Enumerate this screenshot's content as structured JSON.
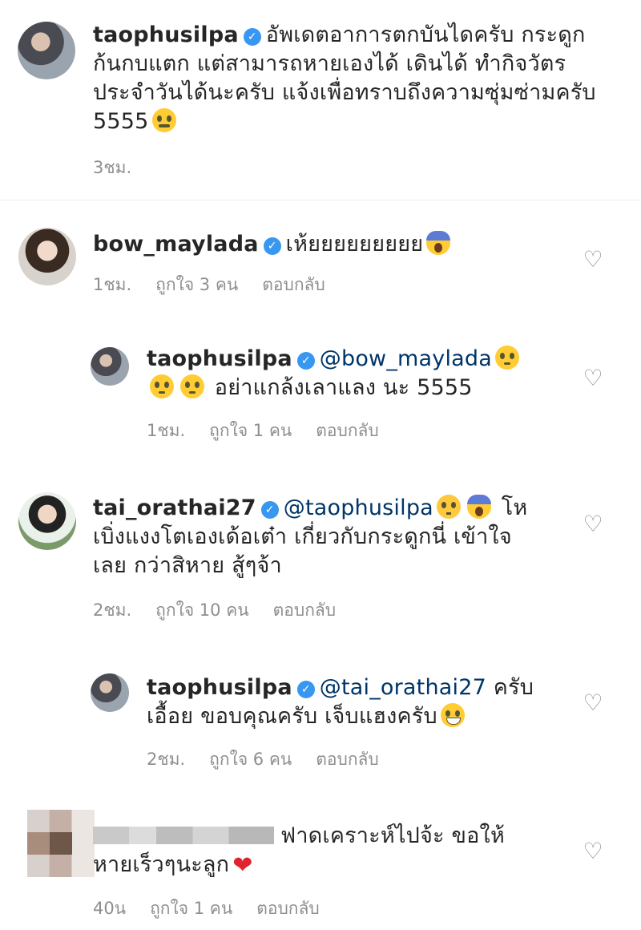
{
  "post": {
    "username": "taophusilpa",
    "caption_line1": "อัพเดตอาการตกบันไดครับ กระดูก",
    "caption_line2": "ก้นกบแตก แต่สามารถหายเองได้ เดินได้ ทำกิจวัตร",
    "caption_line3": "ประจำวันได้นะครับ แจ้งเพื่อทราบถึงความซุ่มซ่ามครับ",
    "caption_line4": "5555",
    "caption_emoji": "confounded-face-icon",
    "time": "3ชม."
  },
  "comments": [
    {
      "username": "bow_maylada",
      "text": "เห้ยยยยยยยยย",
      "emoji": "scream-icon",
      "time": "1ชม.",
      "likes": "ถูกใจ 3 คน",
      "reply_label": "ตอบกลับ"
    },
    {
      "username": "taophusilpa",
      "mention": "@bow_maylada",
      "text": "อย่าแกล้งเลาแลง นะ 5555",
      "time": "1ชม.",
      "likes": "ถูกใจ 1 คน",
      "reply_label": "ตอบกลับ"
    },
    {
      "username": "tai_orathai27",
      "mention": "@taophusilpa",
      "text_line1": "โห",
      "text_line2": "เบิ่งแงงโตเองเด้อเต๋า เกี่ยวกับกระดูกนี่ เข้าใจ",
      "text_line3": "เลย กว่าสิหาย สู้ๆจ้า",
      "time": "2ชม.",
      "likes": "ถูกใจ 10 คน",
      "reply_label": "ตอบกลับ"
    },
    {
      "username": "taophusilpa",
      "mention": "@tai_orathai27",
      "text_line1": "ครับ",
      "text_line2": "เอื้อย ขอบคุณครับ เจ็บแฮงครับ",
      "time": "2ชม.",
      "likes": "ถูกใจ 6 คน",
      "reply_label": "ตอบกลับ"
    },
    {
      "username": "",
      "text_line1": "ฟาดเคราะห์ไปจ้ะ ขอให้",
      "text_line2": "หายเร็วๆนะลูก",
      "time": "40น",
      "likes": "ถูกใจ 1 คน",
      "reply_label": "ตอบกลับ"
    }
  ],
  "verified_mark": "✓",
  "like_glyph": "♡",
  "heart_emoji_glyph": "❤"
}
